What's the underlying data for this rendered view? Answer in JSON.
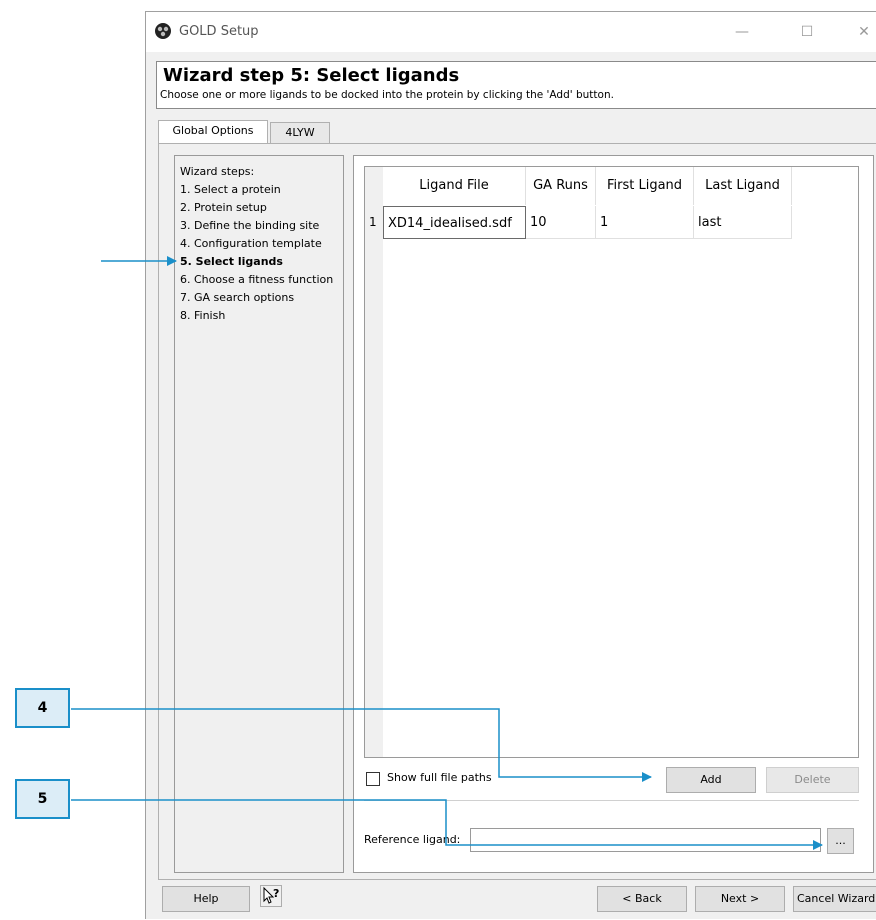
{
  "window": {
    "title": "GOLD Setup",
    "minimize_glyph": "—",
    "maximize_glyph": "☐",
    "close_glyph": "✕"
  },
  "header": {
    "title": "Wizard step 5: Select ligands",
    "description": "Choose one or more ligands to be docked into the protein by clicking the 'Add' button."
  },
  "tabs": [
    {
      "label": "Global Options",
      "active": true
    },
    {
      "label": "4LYW",
      "active": false
    }
  ],
  "wizard": {
    "heading": "Wizard steps:",
    "steps": [
      "1. Select a protein",
      "2. Protein setup",
      "3. Define the binding site",
      "4. Configuration template",
      "5. Select ligands",
      "6. Choose a fitness function",
      "7. GA search options",
      "8. Finish"
    ],
    "current_step_index": 4
  },
  "table": {
    "columns": [
      "Ligand File",
      "GA Runs",
      "First Ligand",
      "Last Ligand"
    ],
    "rows": [
      {
        "index": "1",
        "cells": [
          "XD14_idealised.sdf",
          "10",
          "1",
          "last"
        ]
      }
    ]
  },
  "options": {
    "show_full_paths_label": "Show full file paths",
    "show_full_paths_checked": false,
    "add_label": "Add",
    "delete_label": "Delete",
    "reference_label": "Reference ligand:",
    "reference_value": "",
    "browse_label": "..."
  },
  "bottom": {
    "help_label": "Help",
    "whats_this_glyph": "?",
    "back_label": "< Back",
    "next_label": "Next >",
    "cancel_label": "Cancel Wizard"
  },
  "annotations": [
    {
      "label": "4"
    },
    {
      "label": "5"
    }
  ],
  "colors": {
    "accent": "#1a8fc9",
    "callout_fill": "#dcedf7",
    "window_bg": "#f0f0f0"
  }
}
